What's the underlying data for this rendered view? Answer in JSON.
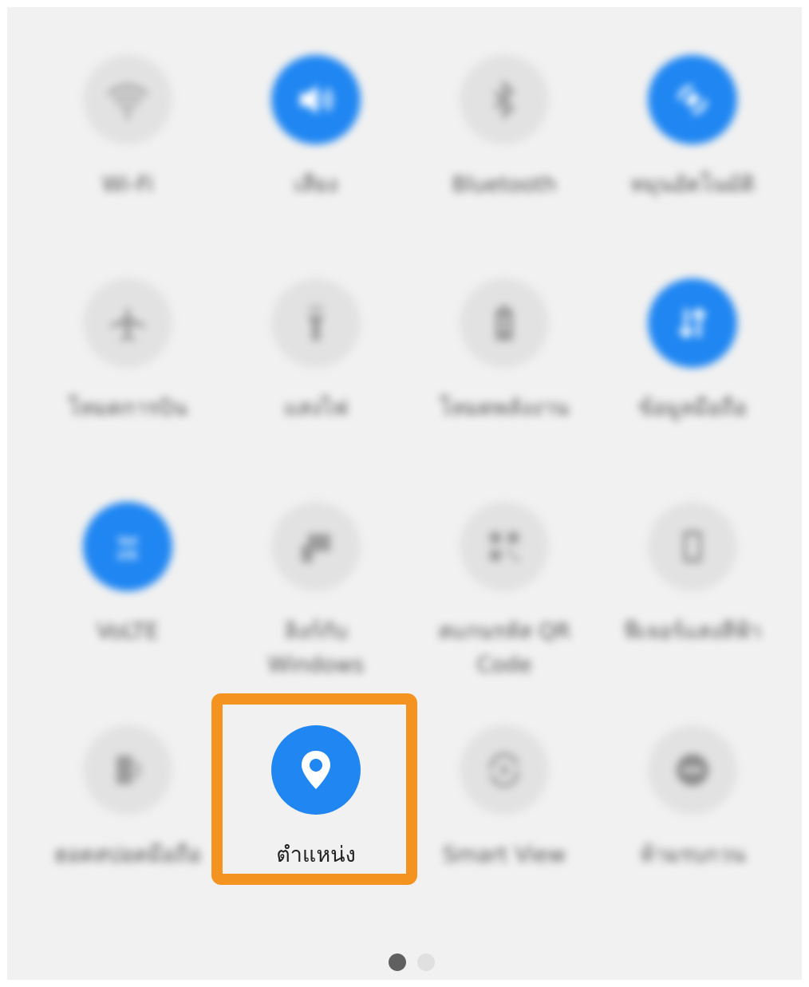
{
  "tiles": [
    {
      "label": "Wi-Fi",
      "icon": "wifi-icon",
      "on": false
    },
    {
      "label": "เสียง",
      "icon": "sound-icon",
      "on": true
    },
    {
      "label": "Bluetooth",
      "icon": "bluetooth-icon",
      "on": false
    },
    {
      "label": "หมุนอัตโนมัติ",
      "icon": "auto-rotate-icon",
      "on": true
    },
    {
      "label": "โหมดการบิน",
      "icon": "airplane-icon",
      "on": false
    },
    {
      "label": "แสงไฟ",
      "icon": "flashlight-icon",
      "on": false
    },
    {
      "label": "โหมดพลังงาน",
      "icon": "power-mode-icon",
      "on": false
    },
    {
      "label": "ข้อมูลมือถือ",
      "icon": "mobile-data-icon",
      "on": true
    },
    {
      "label": "VoLTE",
      "icon": "volte-icon",
      "on": true
    },
    {
      "label": "ลิงก์กับ Windows",
      "icon": "link-windows-icon",
      "on": false
    },
    {
      "label": "สแกนรหัส QR Code",
      "icon": "qr-code-icon",
      "on": false
    },
    {
      "label": "ฟีเจอร์แสงสีฟ้า",
      "icon": "blue-light-icon",
      "on": false
    },
    {
      "label": "ฮอตสปอตมือถือ",
      "icon": "hotspot-icon",
      "on": false
    },
    {
      "label": "ตำแหน่ง",
      "icon": "location-pin-icon",
      "on": true
    },
    {
      "label": "Smart View",
      "icon": "smart-view-icon",
      "on": false
    },
    {
      "label": "ห้ามรบกวน",
      "icon": "do-not-disturb-icon",
      "on": false
    }
  ],
  "page_indicator": {
    "current": 1,
    "total": 2
  },
  "colors": {
    "accent": "#1f86f2",
    "highlight": "#f4931f",
    "tile_off": "#e2e2e2",
    "panel": "#f1f1f1"
  }
}
